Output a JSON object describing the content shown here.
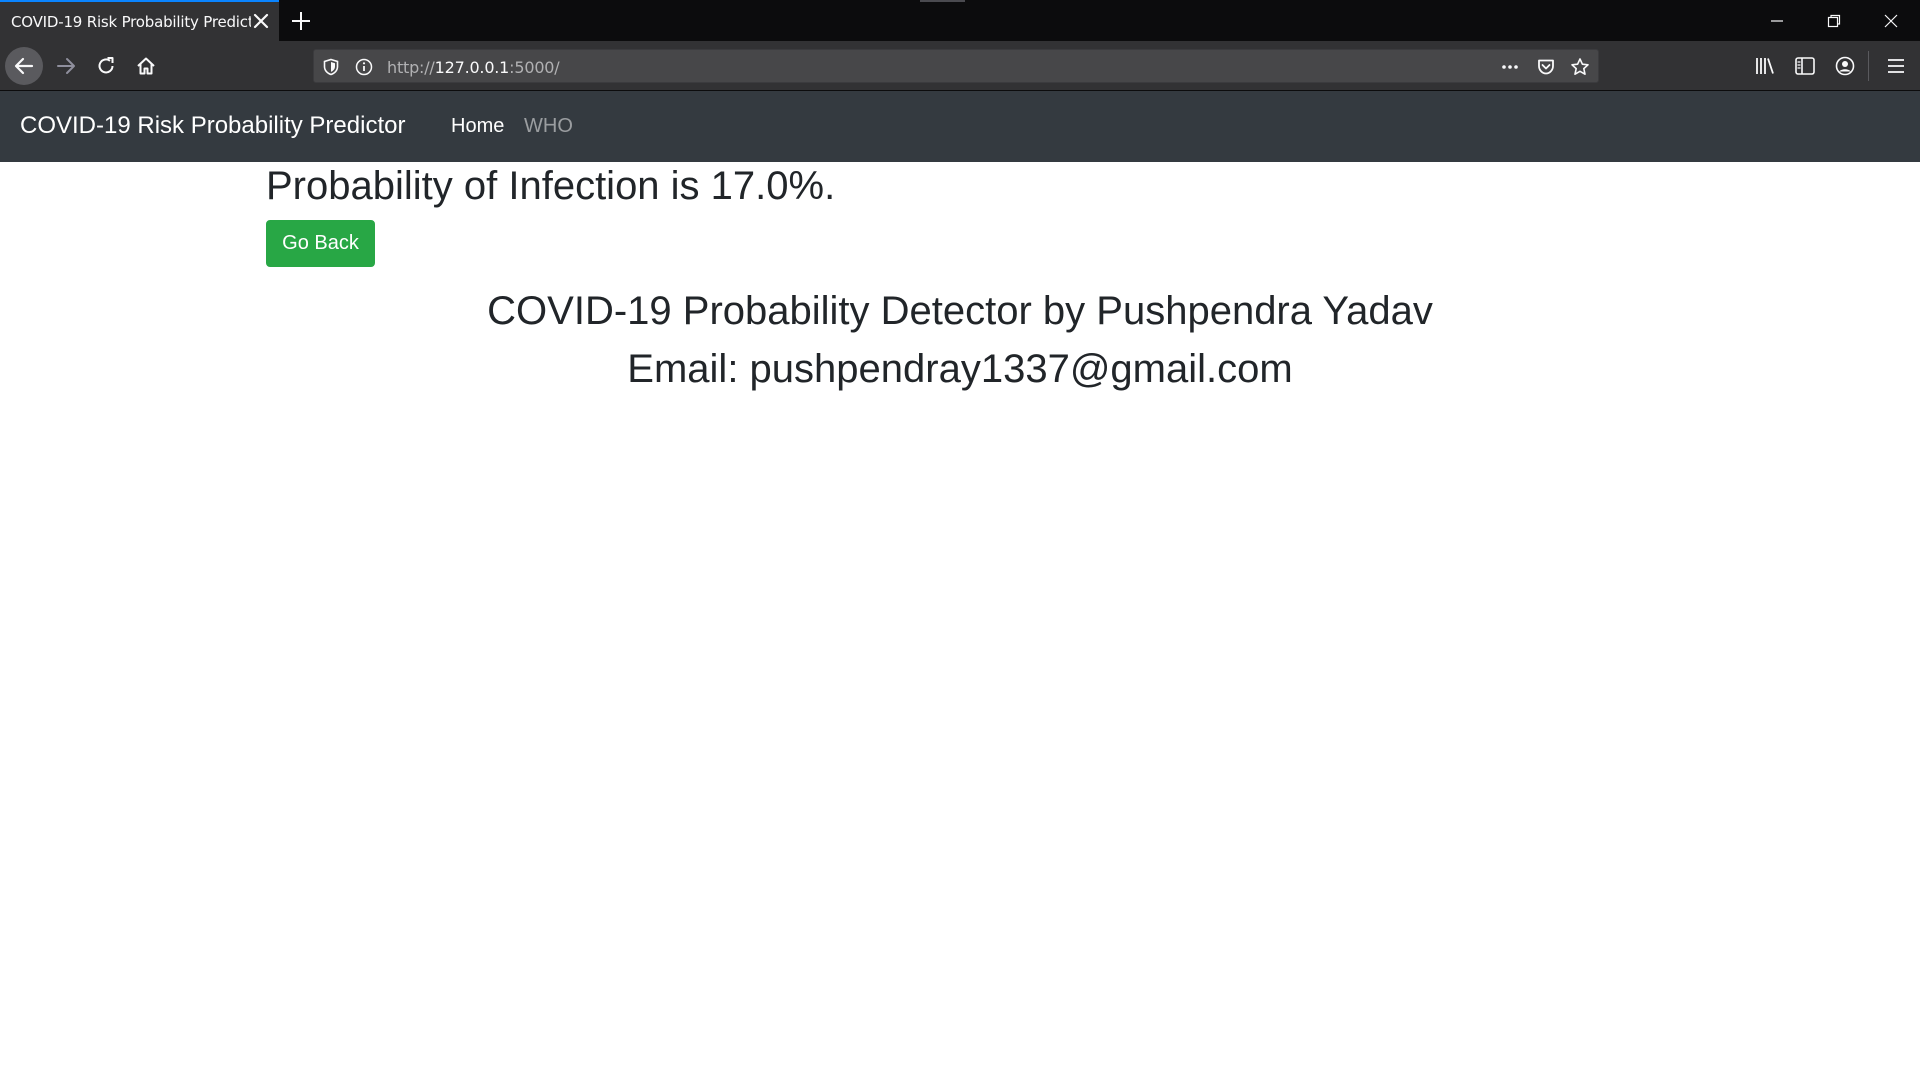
{
  "browser": {
    "tab": {
      "title": "COVID-19 Risk Probability Predictor"
    },
    "url": {
      "scheme": "http://",
      "host": "127.0.0.1",
      "rest": ":5000/"
    },
    "icons": {
      "tab_close": "close-icon",
      "new_tab": "plus-icon",
      "minimize": "minimize-icon",
      "restore": "restore-icon",
      "close_window": "close-icon",
      "back": "arrow-left-icon",
      "forward": "arrow-right-icon",
      "reload": "reload-icon",
      "home": "home-icon",
      "tracking": "shield-icon",
      "site_info": "info-icon",
      "page_actions": "more-horizontal-icon",
      "pocket": "pocket-icon",
      "bookmark": "star-icon",
      "library": "library-icon",
      "sidebar": "sidebar-icon",
      "account": "account-icon",
      "menu": "hamburger-menu-icon"
    }
  },
  "site": {
    "brand": "COVID-19 Risk Probability Predictor",
    "nav": [
      {
        "label": "Home"
      },
      {
        "label": "WHO"
      }
    ]
  },
  "main": {
    "result_text": "Probability of Infection is 17.0%.",
    "go_back_label": "Go Back",
    "footer_line1": "COVID-19 Probability Detector by Pushpendra Yadav",
    "footer_line2": "Email: pushpendray1337@gmail.com"
  },
  "colors": {
    "site_nav_bg": "#343a40",
    "button_green": "#28a745",
    "text_dark": "#212529",
    "chrome_dark": "#0c0c0d",
    "chrome_toolbar": "#323234",
    "tab_accent": "#0a84ff"
  }
}
